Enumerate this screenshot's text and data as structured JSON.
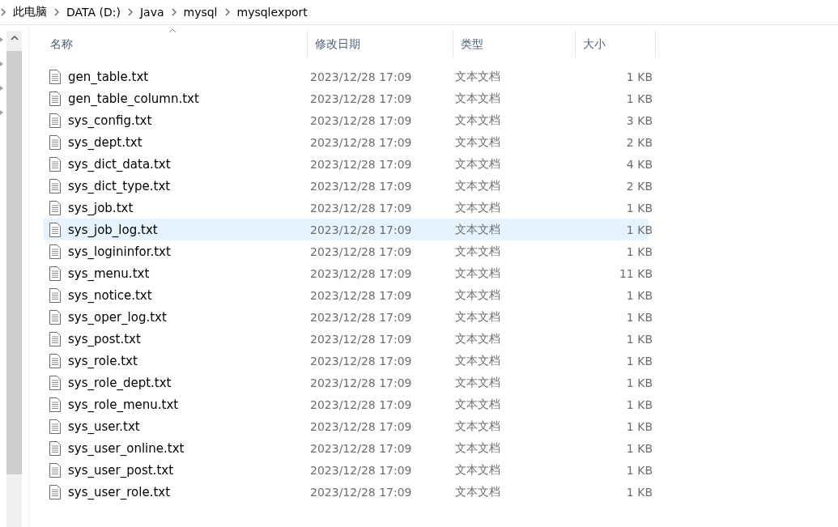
{
  "breadcrumb": [
    "此电脑",
    "DATA (D:)",
    "Java",
    "mysql",
    "mysqlexport"
  ],
  "table": {
    "columns": [
      "名称",
      "修改日期",
      "类型",
      "大小"
    ],
    "rows": [
      {
        "name": "gen_table.txt",
        "date": "2023/12/28 17:09",
        "type": "文本文档",
        "size": "1 KB",
        "selected": false
      },
      {
        "name": "gen_table_column.txt",
        "date": "2023/12/28 17:09",
        "type": "文本文档",
        "size": "1 KB",
        "selected": false
      },
      {
        "name": "sys_config.txt",
        "date": "2023/12/28 17:09",
        "type": "文本文档",
        "size": "3 KB",
        "selected": false
      },
      {
        "name": "sys_dept.txt",
        "date": "2023/12/28 17:09",
        "type": "文本文档",
        "size": "2 KB",
        "selected": false
      },
      {
        "name": "sys_dict_data.txt",
        "date": "2023/12/28 17:09",
        "type": "文本文档",
        "size": "4 KB",
        "selected": false
      },
      {
        "name": "sys_dict_type.txt",
        "date": "2023/12/28 17:09",
        "type": "文本文档",
        "size": "2 KB",
        "selected": false
      },
      {
        "name": "sys_job.txt",
        "date": "2023/12/28 17:09",
        "type": "文本文档",
        "size": "1 KB",
        "selected": false
      },
      {
        "name": "sys_job_log.txt",
        "date": "2023/12/28 17:09",
        "type": "文本文档",
        "size": "1 KB",
        "selected": true
      },
      {
        "name": "sys_logininfor.txt",
        "date": "2023/12/28 17:09",
        "type": "文本文档",
        "size": "1 KB",
        "selected": false
      },
      {
        "name": "sys_menu.txt",
        "date": "2023/12/28 17:09",
        "type": "文本文档",
        "size": "11 KB",
        "selected": false
      },
      {
        "name": "sys_notice.txt",
        "date": "2023/12/28 17:09",
        "type": "文本文档",
        "size": "1 KB",
        "selected": false
      },
      {
        "name": "sys_oper_log.txt",
        "date": "2023/12/28 17:09",
        "type": "文本文档",
        "size": "1 KB",
        "selected": false
      },
      {
        "name": "sys_post.txt",
        "date": "2023/12/28 17:09",
        "type": "文本文档",
        "size": "1 KB",
        "selected": false
      },
      {
        "name": "sys_role.txt",
        "date": "2023/12/28 17:09",
        "type": "文本文档",
        "size": "1 KB",
        "selected": false
      },
      {
        "name": "sys_role_dept.txt",
        "date": "2023/12/28 17:09",
        "type": "文本文档",
        "size": "1 KB",
        "selected": false
      },
      {
        "name": "sys_role_menu.txt",
        "date": "2023/12/28 17:09",
        "type": "文本文档",
        "size": "1 KB",
        "selected": false
      },
      {
        "name": "sys_user.txt",
        "date": "2023/12/28 17:09",
        "type": "文本文档",
        "size": "1 KB",
        "selected": false
      },
      {
        "name": "sys_user_online.txt",
        "date": "2023/12/28 17:09",
        "type": "文本文档",
        "size": "1 KB",
        "selected": false
      },
      {
        "name": "sys_user_post.txt",
        "date": "2023/12/28 17:09",
        "type": "文本文档",
        "size": "1 KB",
        "selected": false
      },
      {
        "name": "sys_user_role.txt",
        "date": "2023/12/28 17:09",
        "type": "文本文档",
        "size": "1 KB",
        "selected": false
      }
    ]
  }
}
